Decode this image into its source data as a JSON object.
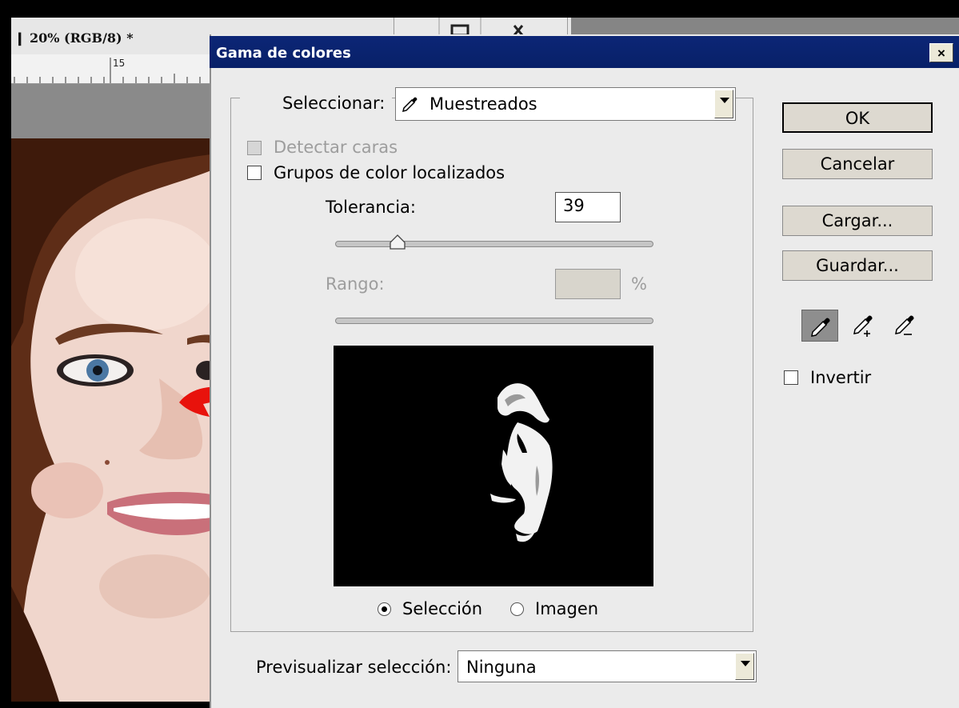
{
  "document": {
    "title_fragment": "20% (RGB/8) *",
    "ruler_number": "15"
  },
  "dialog": {
    "title": "Gama de colores",
    "close_label": "×",
    "select_label": "Seleccionar:",
    "select_value": "Muestreados",
    "detect_faces_label": "Detectar caras",
    "detect_faces_checked": false,
    "localized_groups_label": "Grupos de color localizados",
    "localized_groups_checked": false,
    "tolerance_label": "Tolerancia:",
    "tolerance_value": "39",
    "tolerance_slider_fraction": 0.195,
    "range_label": "Rango:",
    "range_value": "",
    "range_unit": "%",
    "view_selection_label": "Selección",
    "view_image_label": "Imagen",
    "view_selected": "selection",
    "preview_select_label": "Previsualizar selección:",
    "preview_select_value": "Ninguna",
    "buttons": {
      "ok": "OK",
      "cancel": "Cancelar",
      "load": "Cargar...",
      "save": "Guardar..."
    },
    "tools": [
      "eyedropper-icon",
      "eyedropper-plus-icon",
      "eyedropper-minus-icon"
    ],
    "invert_label": "Invertir",
    "invert_checked": false
  },
  "colors": {
    "titlebar": "#0a236f",
    "dialog_bg": "#ebebeb",
    "arrow": "#e8120c"
  }
}
